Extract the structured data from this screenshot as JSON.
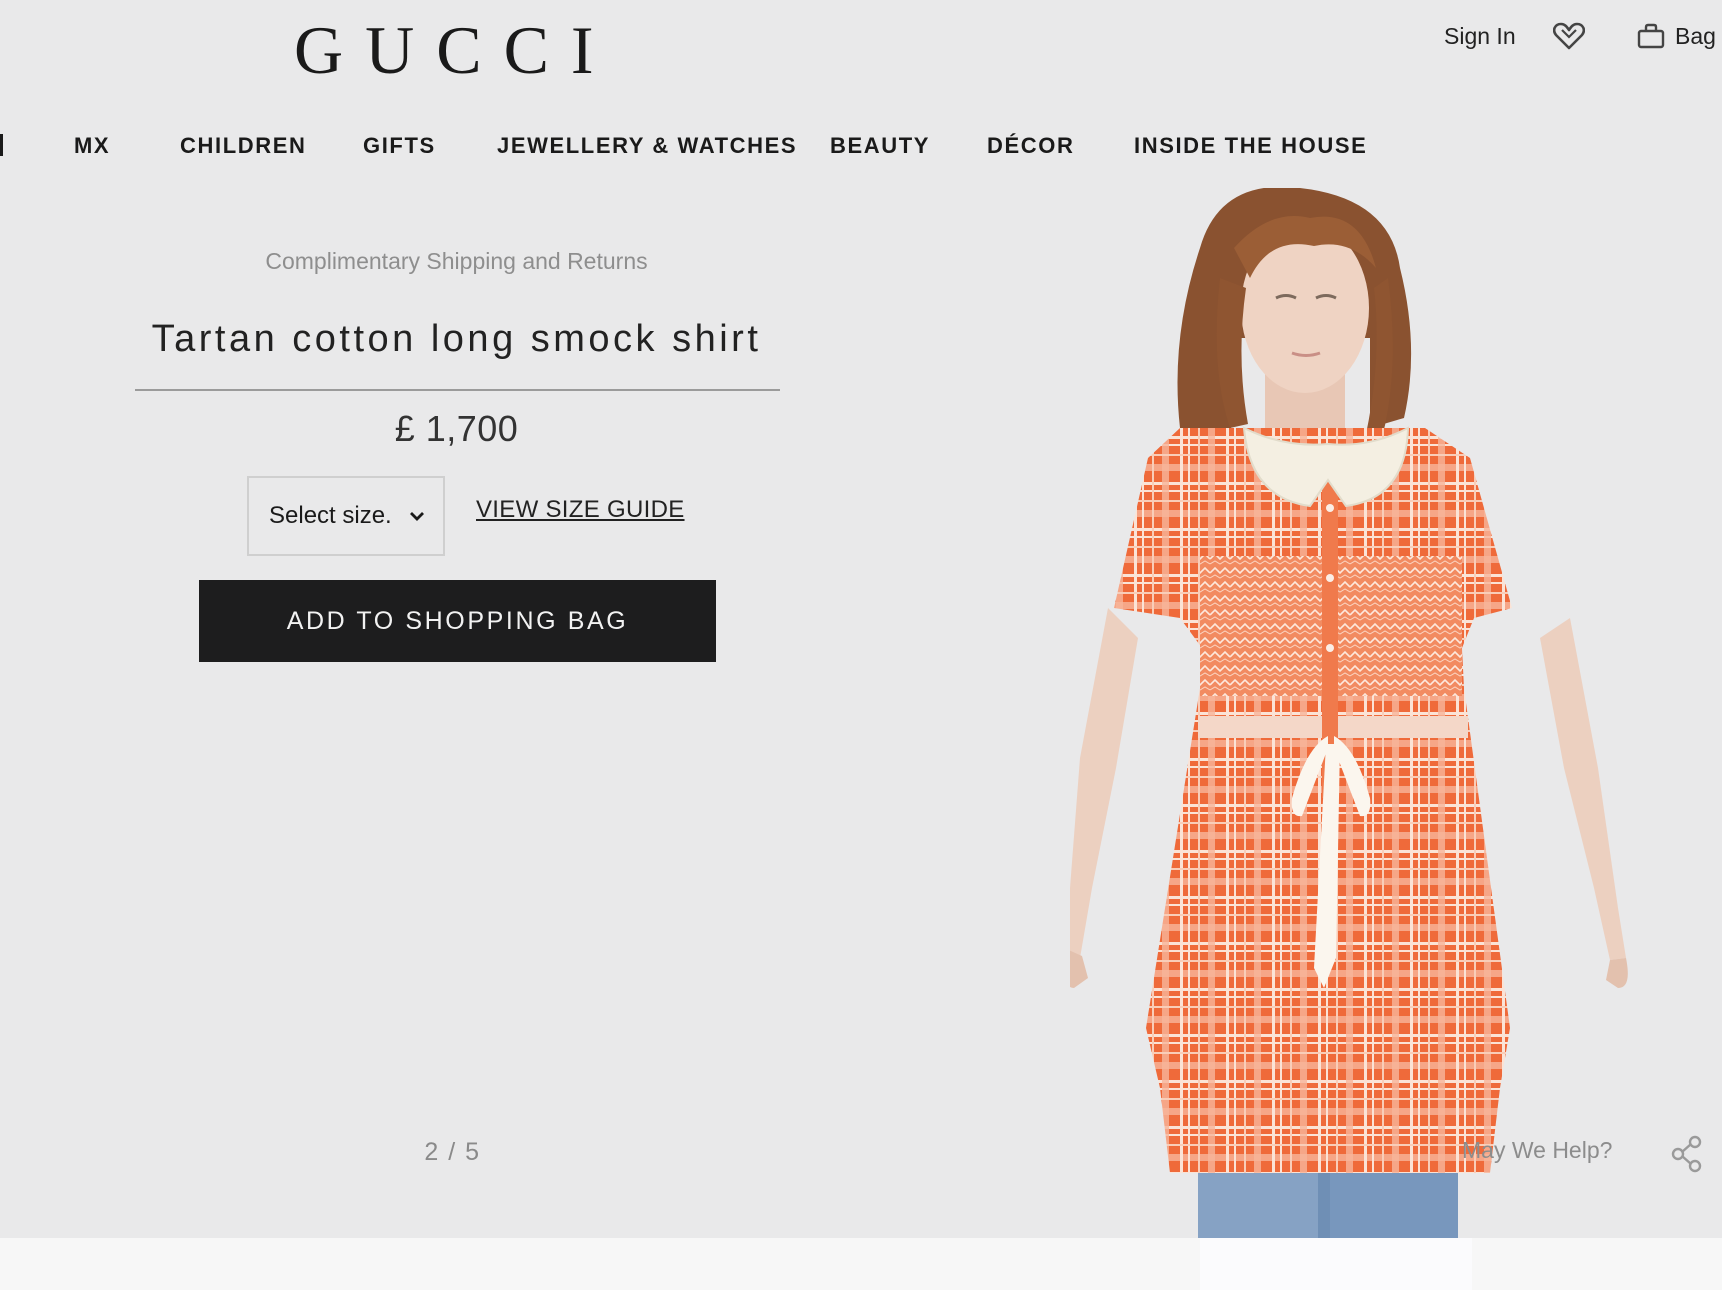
{
  "header": {
    "logo": "GUCCI",
    "sign_in": "Sign In",
    "wishlist_icon": "heart-icon",
    "bag_label": "Bag",
    "bag_icon": "shopping-bag-icon"
  },
  "nav": {
    "items": [
      {
        "label": "MX"
      },
      {
        "label": "CHILDREN"
      },
      {
        "label": "GIFTS"
      },
      {
        "label": "JEWELLERY & WATCHES"
      },
      {
        "label": "BEAUTY"
      },
      {
        "label": "DÉCOR"
      },
      {
        "label": "INSIDE THE HOUSE"
      }
    ]
  },
  "product": {
    "shipping_note": "Complimentary Shipping and Returns",
    "title": "Tartan cotton long smock shirt",
    "price": "£ 1,700",
    "size_select": "Select size.",
    "size_guide": "VIEW SIZE GUIDE",
    "add_to_bag": "ADD TO SHOPPING BAG",
    "image_pager": "2 / 5",
    "dress_color": "#ef6a3a",
    "collar_color": "#f4efe2"
  },
  "footer": {
    "help": "May We Help?",
    "share_icon": "share-icon"
  }
}
